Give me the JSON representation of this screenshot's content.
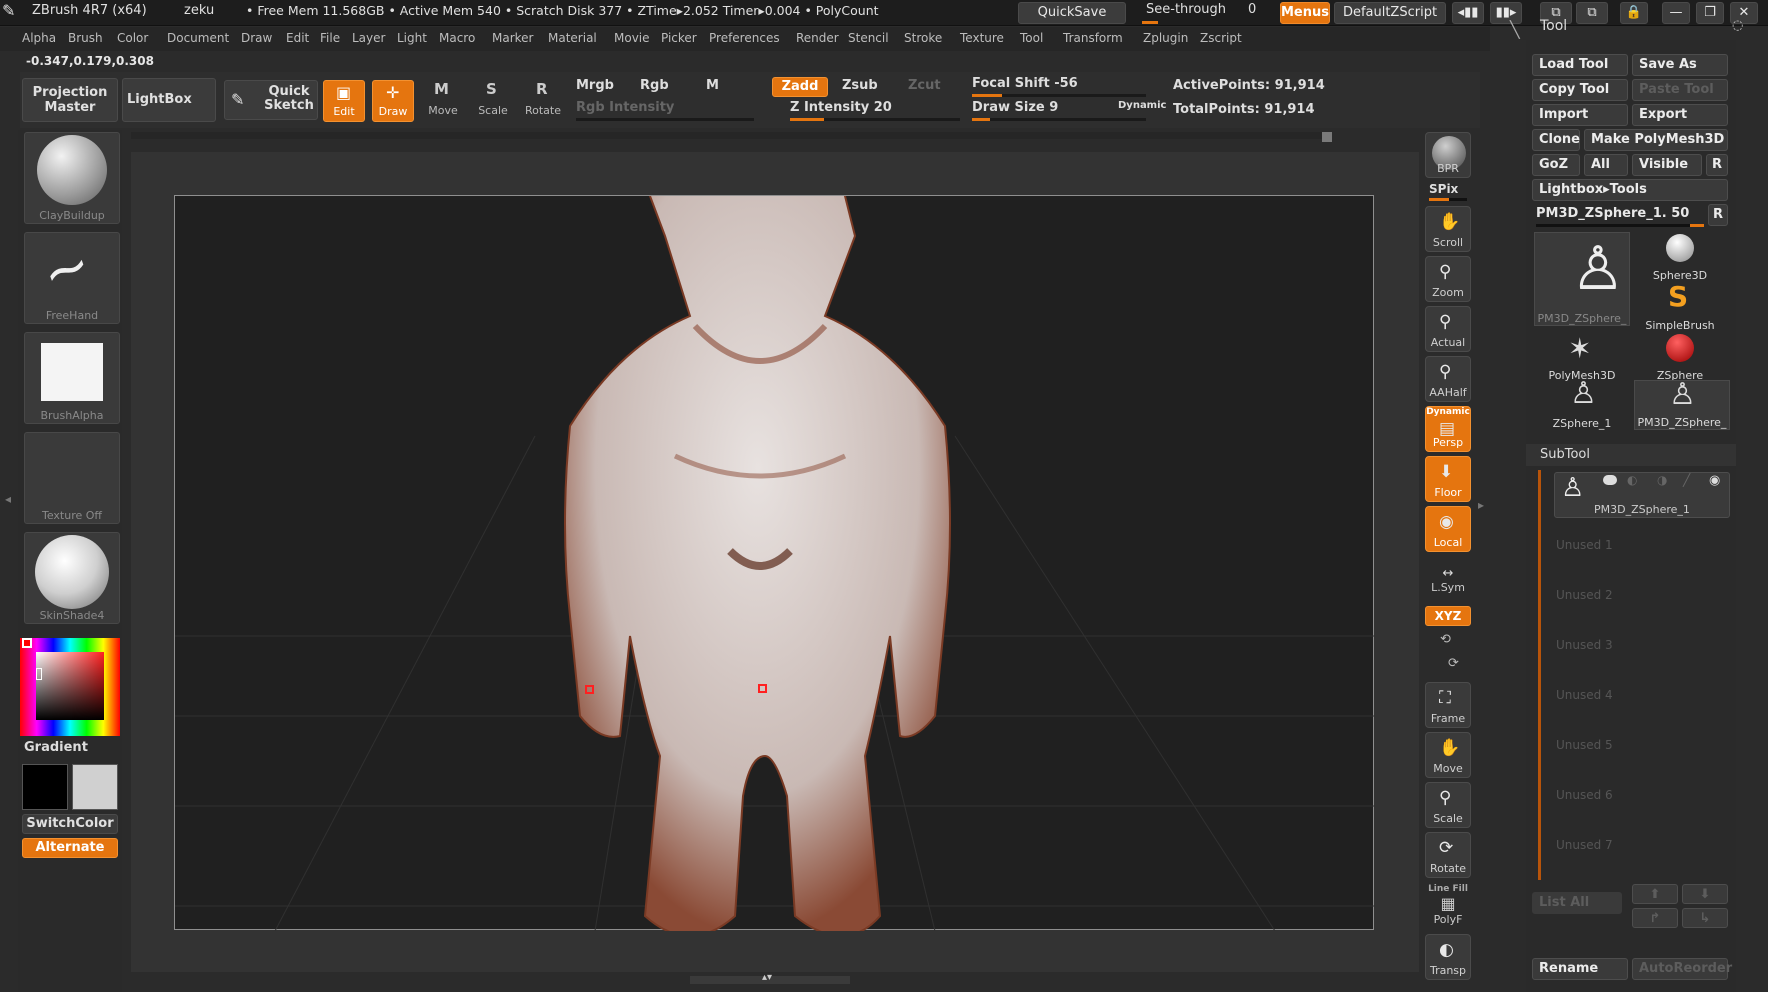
{
  "titlebar": {
    "app_title": "ZBrush 4R7 (x64)",
    "user": "zeku",
    "status": "• Free Mem 11.568GB • Active Mem 540 • Scratch Disk 377 • ZTime▸2.052 Timer▸0.004 • PolyCount",
    "quicksave": "QuickSave",
    "seethrough": "See-through",
    "seethrough_value": "0",
    "menus": "Menus",
    "defaultzscript": "DefaultZScript"
  },
  "menubar": [
    "Alpha",
    "Brush",
    "Color",
    "Document",
    "Draw",
    "Edit",
    "File",
    "Layer",
    "Light",
    "Macro",
    "Marker",
    "Material",
    "Movie",
    "Picker",
    "Preferences",
    "Render",
    "Stencil",
    "Stroke",
    "Texture",
    "Tool",
    "Transform",
    "Zplugin",
    "Zscript"
  ],
  "coords": "-0.347,0.179,0.308",
  "toolbar": {
    "projection_master": "Projection Master",
    "lightbox": "LightBox",
    "quick_sketch": "Quick Sketch",
    "edit": "Edit",
    "draw": "Draw",
    "move": "Move",
    "scale": "Scale",
    "rotate": "Rotate",
    "mrgb": "Mrgb",
    "rgb": "Rgb",
    "m": "M",
    "rgb_intensity": "Rgb Intensity",
    "zadd": "Zadd",
    "zsub": "Zsub",
    "zcut": "Zcut",
    "z_intensity": "Z Intensity 20",
    "focal_shift": "Focal Shift -56",
    "draw_size": "Draw Size 9",
    "dynamic": "Dynamic",
    "active_points": "ActivePoints: 91,914",
    "total_points": "TotalPoints: 91,914"
  },
  "left": {
    "brush": "ClayBuildup",
    "stroke": "FreeHand",
    "alpha": "BrushAlpha",
    "texture": "Texture Off",
    "material": "SkinShade4",
    "gradient": "Gradient",
    "switchcolor": "SwitchColor",
    "alternate": "Alternate"
  },
  "shelf": {
    "bpr": "BPR",
    "spix": "SPix",
    "scroll": "Scroll",
    "zoom": "Zoom",
    "actual": "Actual",
    "aahalf": "AAHalf",
    "dynamic": "Dynamic",
    "persp": "Persp",
    "floor": "Floor",
    "local": "Local",
    "lsym": "L.Sym",
    "xyz": "XYZ",
    "frame": "Frame",
    "move": "Move",
    "scale": "Scale",
    "rotate": "Rotate",
    "linefill": "Line Fill",
    "polyf": "PolyF",
    "transp": "Transp"
  },
  "tool": {
    "title": "Tool",
    "load_tool": "Load Tool",
    "save_as": "Save As",
    "copy_tool": "Copy Tool",
    "paste_tool": "Paste Tool",
    "import": "Import",
    "export": "Export",
    "clone": "Clone",
    "make_polymesh": "Make PolyMesh3D",
    "goz": "GoZ",
    "all": "All",
    "visible": "Visible",
    "r": "R",
    "lightbox_tools": "Lightbox▸Tools",
    "current_tool": "PM3D_ZSphere_1. 50",
    "items": [
      "PM3D_ZSphere_",
      "Sphere3D",
      "SimpleBrush",
      "PolyMesh3D",
      "ZSphere",
      "ZSphere_1",
      "PM3D_ZSphere_"
    ],
    "subtool_title": "SubTool",
    "subtool_active": "PM3D_ZSphere_1",
    "unused": [
      "Unused 1",
      "Unused 2",
      "Unused 3",
      "Unused 4",
      "Unused 5",
      "Unused 6",
      "Unused 7"
    ],
    "list_all": "List All",
    "rename": "Rename",
    "autoreorder": "AutoReorder"
  }
}
